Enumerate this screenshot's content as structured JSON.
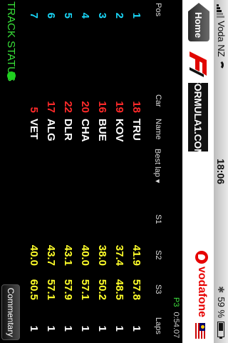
{
  "status_bar": {
    "carrier": "Voda NZ",
    "time": "18:06",
    "battery": "59 %",
    "battery_level": 0.59
  },
  "header": {
    "home_label": "Home",
    "formula1_logo_text": "FORMULA1.COM",
    "sponsor": "vodafone"
  },
  "session": {
    "position": "P3",
    "elapsed": "0:54.07"
  },
  "table": {
    "columns": {
      "pos": "Pos",
      "car": "Car",
      "name": "Name",
      "best_lap": "Best lap ▾",
      "s1": "S1",
      "s2": "S2",
      "s3": "S3",
      "laps": "Laps"
    },
    "rows": [
      {
        "pos": "1",
        "car": "18",
        "name": "TRU",
        "s1": "",
        "s2": "41.9",
        "s3": "57.8",
        "laps": "1"
      },
      {
        "pos": "2",
        "car": "19",
        "name": "KOV",
        "s1": "",
        "s2": "37.4",
        "s3": "48.5",
        "laps": "1"
      },
      {
        "pos": "3",
        "car": "16",
        "name": "BUE",
        "s1": "",
        "s2": "38.0",
        "s3": "50.2",
        "laps": "1"
      },
      {
        "pos": "4",
        "car": "20",
        "name": "CHA",
        "s1": "",
        "s2": "40.0",
        "s3": "57.1",
        "laps": "1"
      },
      {
        "pos": "5",
        "car": "22",
        "name": "DLR",
        "s1": "",
        "s2": "43.1",
        "s3": "57.9",
        "laps": "1"
      },
      {
        "pos": "6",
        "car": "17",
        "name": "ALG",
        "s1": "",
        "s2": "43.7",
        "s3": "57.1",
        "laps": "1"
      },
      {
        "pos": "7",
        "car": "5",
        "name": "VET",
        "s1": "",
        "s2": "40.0",
        "s3": "60.5",
        "laps": "1"
      }
    ]
  },
  "footer": {
    "track_status_label": "TRACK STATUS",
    "commentary_label": "Commentary"
  },
  "colors": {
    "position": "#19d4f5",
    "car_number": "#ff2a2a",
    "sector": "#ffff2a",
    "track_status": "#38e038"
  }
}
